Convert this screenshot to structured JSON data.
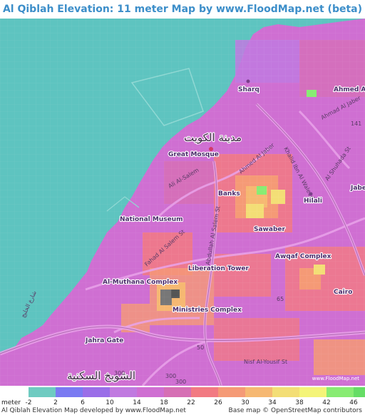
{
  "title": "Al Qiblah Elevation: 11 meter Map by www.FloodMap.net (beta)",
  "colors": {
    "sea": "#5ec4c0",
    "title": "#3c8ec9",
    "land_base": "#cf6fd2"
  },
  "map": {
    "labels": {
      "sharq": "Sharq",
      "ahmed_al": "Ahmed Al",
      "ahmed_al_jaber": "Ahmad Al Jaber",
      "kuwait_city_ar": "مدينة الكويت",
      "great_mosque": "Great Mosque",
      "khalid_bin_al_waleed": "Khalid Ibn Al Waleed",
      "al_shuhada": "Al Shuhada St",
      "ahmed_al_jaber_st": "Ahmed Al Jaber",
      "al_al_salem": "Ali Al-Salem",
      "jabe": "Jabe",
      "banks": "Banks",
      "hilali": "Hilali",
      "national_museum": "National Museum",
      "abdullah_al_salem": "Abdullah Al Salem St",
      "sawaber": "Sawaber",
      "fahad_al_salem": "Fahad Al Salem St",
      "awqaf_complex": "Awqaf Complex",
      "liberation_tower": "Liberation Tower",
      "al_muthana_complex": "Al-Muthana Complex",
      "cairo": "Cairo",
      "ministries_complex": "Ministries Complex",
      "jahra_gate": "Jahra Gate",
      "nisf_al_yousif": "Nisf Al-Yousif St",
      "shuwaikh_ar": "الشويخ السكنية",
      "gulf_st_ar": "شارع الخليج",
      "road_141": "141",
      "road_65": "65",
      "road_50": "50",
      "road_300a": "300",
      "road_300b": "300",
      "road_300c": "300"
    }
  },
  "legend": {
    "unit": "meter",
    "ticks": [
      "-2",
      "2",
      "6",
      "10",
      "14",
      "18",
      "22",
      "26",
      "30",
      "34",
      "38",
      "42",
      "46"
    ],
    "colors": [
      "#6fcbc1",
      "#7a7af2",
      "#9a6ee8",
      "#c07ae0",
      "#cf6fd2",
      "#d66fb4",
      "#f27a82",
      "#f59a76",
      "#f6b872",
      "#f3de76",
      "#f4f478",
      "#88ec73",
      "#66dd66"
    ]
  },
  "credit_left": "Al Qiblah Elevation Map developed by www.FloodMap.net",
  "credit_right": "Base map © OpenStreetMap contributors",
  "logo_text": "www.FloodMap.net"
}
